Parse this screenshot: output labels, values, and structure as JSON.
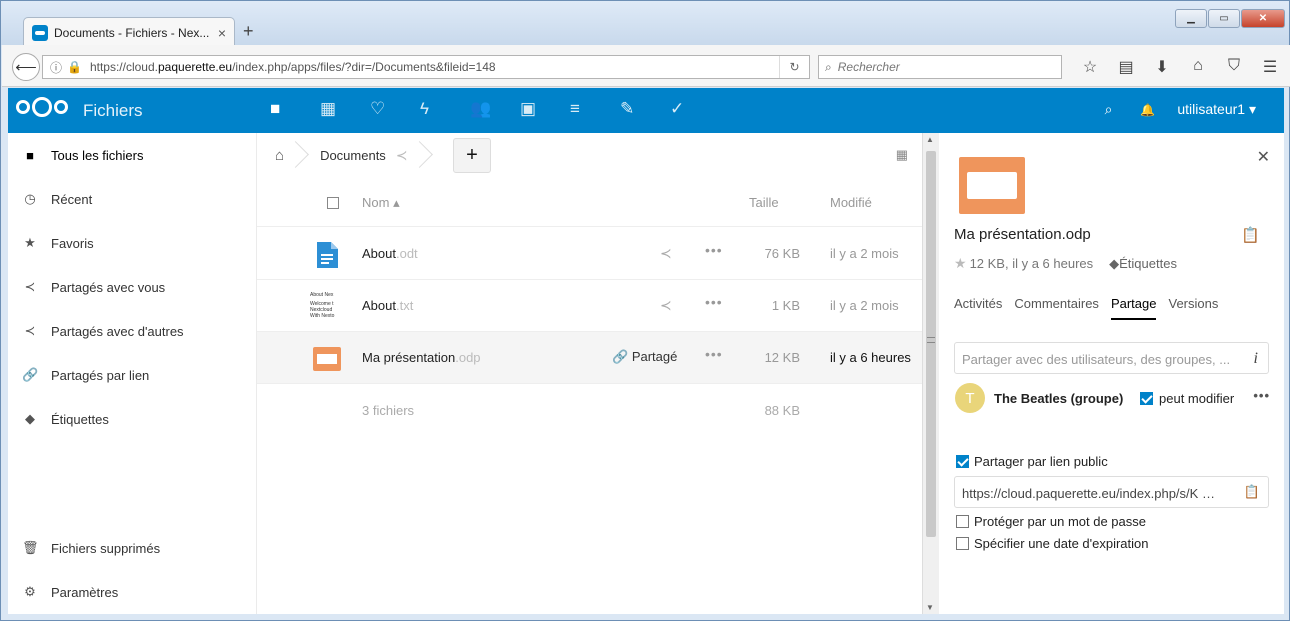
{
  "browser": {
    "tab_title": "Documents - Fichiers - Nex...",
    "tab_close": "×",
    "new_tab": "+",
    "url_prefix": "https://cloud.",
    "url_domain": "paquerette.eu",
    "url_suffix": "/index.php/apps/files/?dir=/Documents&fileid=148",
    "search_placeholder": "Rechercher"
  },
  "header": {
    "app_name": "Fichiers",
    "user": "utilisateur1"
  },
  "sidebar": {
    "items": [
      {
        "label": "Tous les fichiers"
      },
      {
        "label": "Récent"
      },
      {
        "label": "Favoris"
      },
      {
        "label": "Partagés avec vous"
      },
      {
        "label": "Partagés avec d'autres"
      },
      {
        "label": "Partagés par lien"
      },
      {
        "label": "Étiquettes"
      }
    ],
    "trash": "Fichiers supprimés",
    "settings": "Paramètres"
  },
  "breadcrumb": {
    "folder": "Documents",
    "add": "+"
  },
  "table": {
    "headers": {
      "name": "Nom",
      "size": "Taille",
      "modified": "Modifié"
    },
    "rows": [
      {
        "name": "About",
        "ext": ".odt",
        "size": "76 KB",
        "modified": "il y a 2 mois"
      },
      {
        "name": "About",
        "ext": ".txt",
        "size": "1 KB",
        "modified": "il y a 2 mois"
      },
      {
        "name": "Ma présentation",
        "ext": ".odp",
        "shared": "Partagé",
        "size": "12 KB",
        "modified": "il y a 6 heures"
      }
    ],
    "summary": {
      "count": "3 fichiers",
      "size": "88 KB"
    },
    "txt_preview": [
      "About Nex",
      "Welcome t",
      "Nextcloud",
      "With Nexto"
    ]
  },
  "details": {
    "title": "Ma présentation.odp",
    "meta": "12 KB, il y a 6 heures",
    "tags": "Étiquettes",
    "tabs": [
      "Activités",
      "Commentaires",
      "Partage",
      "Versions"
    ],
    "active_tab": "Partage",
    "share_placeholder": "Partager avec des utilisateurs, des groupes, ...",
    "sharee": "The Beatles (groupe)",
    "sharee_initial": "T",
    "can_edit": "peut modifier",
    "public_link_label": "Partager par lien public",
    "public_link": "https://cloud.paquerette.eu/index.php/s/K",
    "password_label": "Protéger par un mot de passe",
    "expiration_label": "Spécifier une date d'expiration"
  },
  "colors": {
    "brand": "#0082c9",
    "odp_icon": "#ef955c",
    "odt_icon": "#2d8fd5"
  }
}
